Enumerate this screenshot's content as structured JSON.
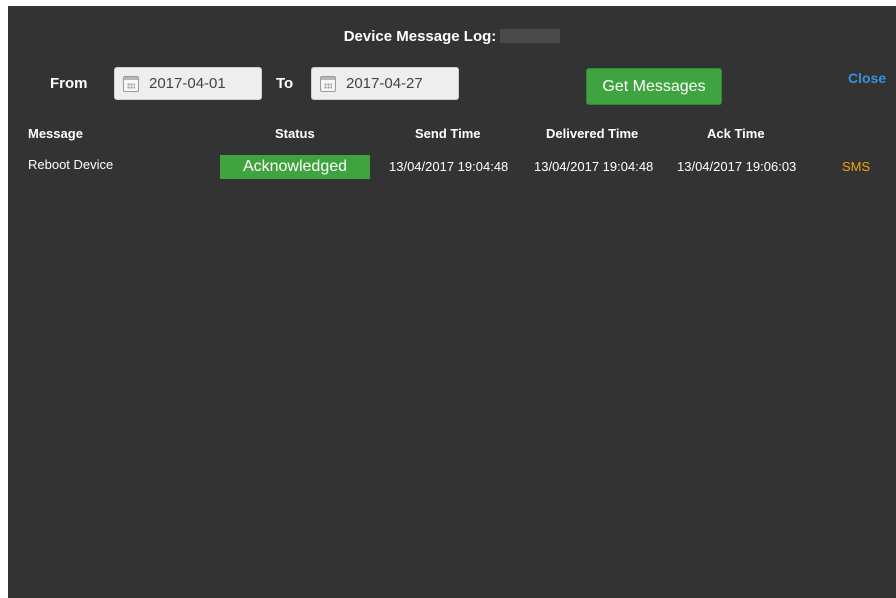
{
  "dialog": {
    "title": "Device Message Log:",
    "close_label": "Close"
  },
  "filters": {
    "from_label": "From",
    "from_value": "2017-04-01",
    "to_label": "To",
    "to_value": "2017-04-27",
    "submit_label": "Get Messages"
  },
  "table": {
    "columns": [
      "Message",
      "Status",
      "Send Time",
      "Delivered Time",
      "Ack Time"
    ],
    "rows": [
      {
        "message": "Reboot Device",
        "status": "Acknowledged",
        "send_time": "13/04/2017 19:04:48",
        "delivered_time": "13/04/2017 19:04:48",
        "ack_time": "13/04/2017 19:06:03",
        "channel": "SMS"
      }
    ]
  },
  "colors": {
    "background": "#333333",
    "accent_green": "#3fa33f",
    "link_blue": "#3a8fd8",
    "channel_orange": "#f0a30a"
  },
  "icons": [
    "calendar-icon"
  ]
}
